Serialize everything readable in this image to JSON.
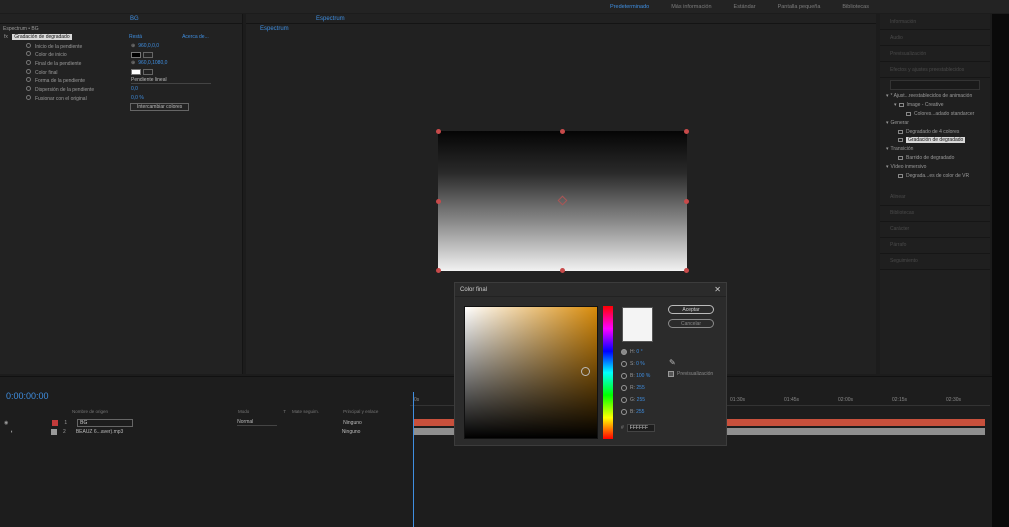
{
  "menu": {
    "workspaces": [
      "Predeterminado",
      "Más información",
      "Estándar",
      "Pantalla pequeña",
      "Bibliotecas"
    ],
    "active_workspace": "Predeterminado"
  },
  "effect_panel": {
    "tab_label": "BG",
    "layer_label": "Espectrum • BG",
    "effect_name": "Gradación de degradado",
    "reset_label": "Restá",
    "about_label": "Acerca de...",
    "properties": [
      {
        "name": "Inicio de la pendiente",
        "value": "960,0,0,0"
      },
      {
        "name": "Color de inicio",
        "value": ""
      },
      {
        "name": "Final de la pendiente",
        "value": "960,0,1080,0"
      },
      {
        "name": "Color final",
        "value": ""
      },
      {
        "name": "Forma de la pendiente",
        "value": "Pendiente lineal"
      },
      {
        "name": "Dispersión de la pendiente",
        "value": "0,0"
      },
      {
        "name": "Fusionar con el original",
        "value": "0,0 %"
      }
    ],
    "swap_button": "Intercambiar colores"
  },
  "comp_panel": {
    "tab_label": "Espectrum",
    "subtab": "Espectrum"
  },
  "right_panel": {
    "headers": [
      "Información",
      "Audio",
      "Previsualización",
      "Efectos y ajustes preestablecidos"
    ],
    "tree": [
      {
        "label": "* Ajust...reestablecidos de animación",
        "level": 0
      },
      {
        "label": "Image - Creative",
        "level": 1
      },
      {
        "label": "Colores...adado standarcer",
        "level": 2
      },
      {
        "label": "Generar",
        "level": 0
      },
      {
        "label": "Degradado de 4 colores",
        "level": 1
      },
      {
        "label": "Gradación de degradado",
        "level": 1,
        "selected": true
      },
      {
        "label": "Transición",
        "level": 0
      },
      {
        "label": "Barrido de degradado",
        "level": 1
      },
      {
        "label": "Vídeo inmersivo",
        "level": 0
      },
      {
        "label": "Degrada...es de color de VR",
        "level": 1
      }
    ],
    "lower_headers": [
      "Alinear",
      "Bibliotecas",
      "Carácter",
      "Párrafo",
      "Seguimiento"
    ]
  },
  "timeline": {
    "timecode": "0:00:00:00",
    "columns": {
      "source": "Nombre de origen",
      "mode": "Modo",
      "trkmat": "T",
      "parent": "Principal y enlace",
      "track_matte": "Mate seguim."
    },
    "layers": [
      {
        "num": "1",
        "name": "BG",
        "mode": "Normal",
        "parent": "Ninguno"
      },
      {
        "num": "2",
        "name": "BEAUZ 6...aver).mp3",
        "mode": "",
        "parent": "Ninguno"
      }
    ],
    "ruler": [
      "0s",
      "01:30s",
      "01:45s",
      "02:00s",
      "02:15s",
      "02:30s"
    ]
  },
  "dialog": {
    "title": "Color final",
    "ok": "Aceptar",
    "cancel": "Cancelar",
    "preview_label": "Previsualización",
    "fields": [
      {
        "key": "H",
        "value": "0 °"
      },
      {
        "key": "S",
        "value": "0 %"
      },
      {
        "key": "B",
        "value": "100 %"
      },
      {
        "key": "R",
        "value": "255"
      },
      {
        "key": "G",
        "value": "255"
      },
      {
        "key": "B",
        "value": "255"
      }
    ],
    "hex_prefix": "#",
    "hex": "FFFFFF"
  },
  "colors": {
    "accent": "#3f8ee0",
    "layer_red": "#c23b3b",
    "layer_bar": "#d9503f",
    "audio_bar": "#9a9a9a"
  }
}
